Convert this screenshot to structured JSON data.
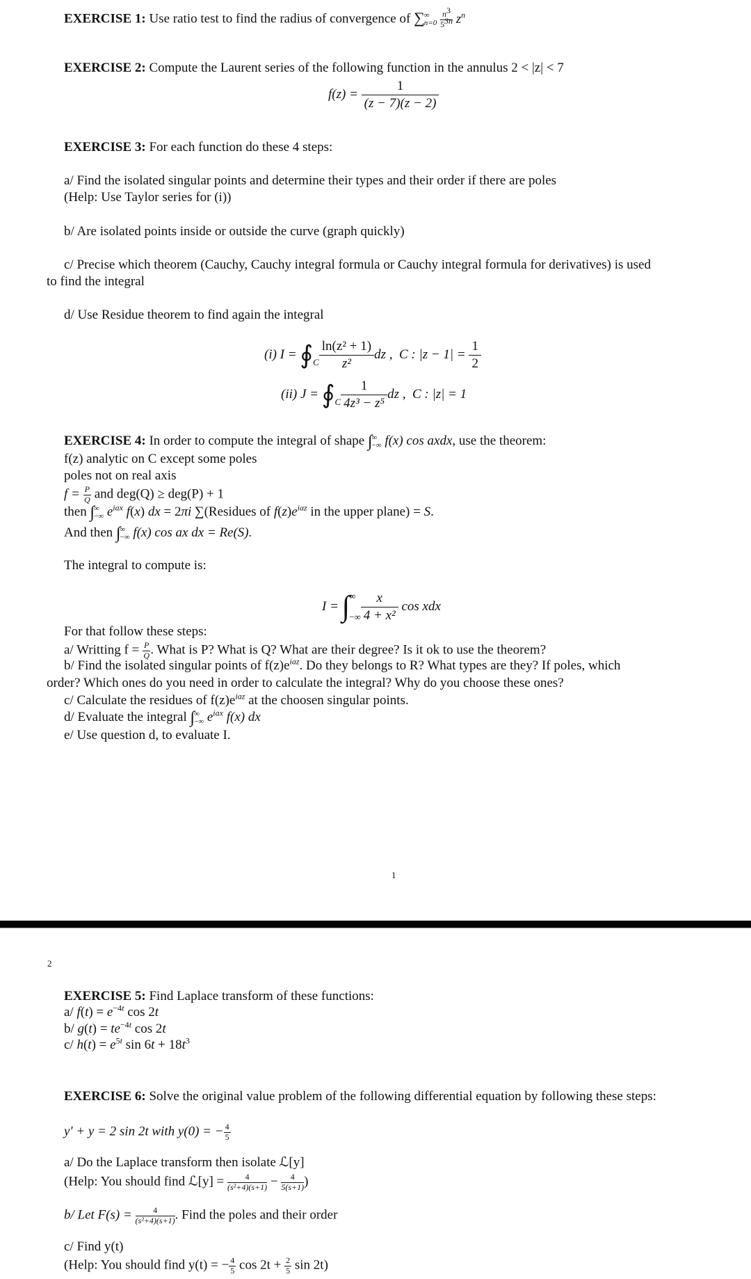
{
  "document": {
    "page1_number": "1",
    "page2_number": "2",
    "exercises": {
      "ex1": {
        "title": "EXERCISE 1:",
        "text": "Use ratio test to find the radius of convergence of",
        "series": {
          "sum": "∑",
          "upper": "∞",
          "lower": "n=0",
          "num": "n",
          "num_exp": "3",
          "den": "5",
          "den_exp": "3n",
          "term": "z",
          "term_exp": "n"
        }
      },
      "ex2": {
        "title": "EXERCISE 2:",
        "text": "Compute the Laurent series of the following function in the annulus 2 < |z| < 7",
        "formula_lhs": "f(z) =",
        "formula_num": "1",
        "formula_den": "(z − 7)(z − 2)"
      },
      "ex3": {
        "title": "EXERCISE 3:",
        "text": "For each function do these 4 steps:",
        "step_a": "a/ Find the isolated singular points and determine their types and their order if there are poles",
        "step_a_help": "(Help: Use Taylor series for (i))",
        "step_b": "b/ Are isolated points inside or outside the curve (graph quickly)",
        "step_c_line1": "c/ Precise which theorem (Cauchy, Cauchy integral formula or Cauchy integral formula for derivatives) is used",
        "step_c_line2": "to find the integral",
        "step_d": "d/ Use Residue theorem to find again the integral",
        "integral_i": {
          "label": "(i)",
          "lhs": "I =",
          "contour_sub": "C",
          "num": "ln(z² + 1)",
          "den": "z²",
          "dz": "dz ,",
          "curve": "C : |z − 1| =",
          "rhs_num": "1",
          "rhs_den": "2"
        },
        "integral_ii": {
          "label": "(ii)",
          "lhs": "J =",
          "contour_sub": "C",
          "num": "1",
          "den": "4z³ − z⁵",
          "dz": "dz ,",
          "curve": "C : |z| = 1"
        }
      },
      "ex4": {
        "title": "EXERCISE 4:",
        "text_before": "In order to compute the integral of shape",
        "text_integral": "f(x) cos axdx,",
        "text_after": "use the theorem:",
        "cond1": "f(z) analytic on C except some poles",
        "cond2": "poles not on real axis",
        "cond3_a": "f =",
        "cond3_num": "P",
        "cond3_den": "Q",
        "cond3_b": "and deg(Q) ≥ deg(P) + 1",
        "then_prefix": "then",
        "then_integrand": "e^{iax} f(x) dx = 2πi ∑(Residues of f(z)e^{iaz} in the upper plane) = S.",
        "andthen_prefix": "And then",
        "andthen_integrand": "f(x) cos ax dx = Re(S).",
        "limit_upper": "∞",
        "limit_lower": "−∞",
        "integral_intro": "The integral to compute is:",
        "main_integral": {
          "lhs": "I =",
          "num": "x",
          "den": "4 + x²",
          "tail": "cos xdx",
          "upper": "∞",
          "lower": "−∞"
        },
        "steps_intro": "For that follow these steps:",
        "step_a_pre": "a/ Writting f =",
        "step_a_post": ". What is P? What is Q? What are their degree? Is it ok to use the theorem?",
        "step_b_line1": "b/ Find the isolated singular points of f(z)e^{iaz}. Do they belongs to R? What types are they? If poles, which",
        "step_b_line2": "order? Which ones do you need in order to calculate the integral? Why do you choose these ones?",
        "step_c": "c/ Calculate the residues of f(z)e^{iaz} at the choosen singular points.",
        "step_d_pre": "d/ Evaluate the integral",
        "step_d_post": "e^{iax} f(x) dx",
        "step_e": "e/ Use question d, to evaluate I."
      },
      "ex5": {
        "title": "EXERCISE 5:",
        "text": "Find Laplace transform of these functions:",
        "items": [
          {
            "label": "a/",
            "expr": "f(t) = e^{−4t} cos 2t"
          },
          {
            "label": "b/",
            "expr": "g(t) = te^{−4t} cos 2t"
          },
          {
            "label": "c/",
            "expr": "h(t) = e^{5t} sin 6t + 18t³"
          }
        ]
      },
      "ex6": {
        "title": "EXERCISE 6:",
        "text": "Solve the original value problem of the following differential equation by following these steps:",
        "equation": "y′ + y = 2 sin 2t with y(0) = −",
        "equation_frac_num": "4",
        "equation_frac_den": "5",
        "step_a": "a/ Do the Laplace transform then isolate ℒ[y]",
        "step_a_help_pre": "(Help: You should find ℒ[y] =",
        "step_a_help_f1_num": "4",
        "step_a_help_f1_den": "(s²+4)(s+1)",
        "step_a_help_minus": "−",
        "step_a_help_f2_num": "4",
        "step_a_help_f2_den": "5(s+1)",
        "step_a_help_post": ")",
        "step_b_pre": "b/ Let F(s) =",
        "step_b_num": "4",
        "step_b_den": "(s²+4)(s+1)",
        "step_b_post": ". Find the poles and their order",
        "step_c": "c/ Find y(t)",
        "step_c_help_pre": "(Help: You should find y(t) = −",
        "step_c_help_f1_num": "4",
        "step_c_help_f1_den": "5",
        "step_c_help_mid": "cos 2t +",
        "step_c_help_f2_num": "2",
        "step_c_help_f2_den": "5",
        "step_c_help_post": "sin 2t)"
      }
    }
  }
}
